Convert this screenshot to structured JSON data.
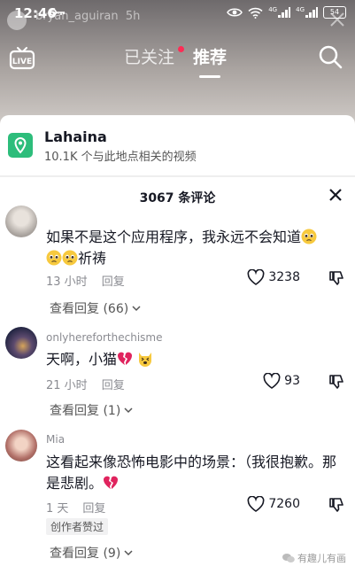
{
  "status_bar": {
    "time": "12:46",
    "signal_1": "4G",
    "signal_2": "4G",
    "battery": "54"
  },
  "underlay": {
    "username": "bryan_aguiran",
    "age": "5h"
  },
  "nav": {
    "live_label": "LIVE",
    "tab_following": "已关注",
    "tab_recommended": "推荐"
  },
  "location": {
    "name": "Lahaina",
    "subtitle": "10.1K 个与此地点相关的视频"
  },
  "comments_panel": {
    "title": "3067 条评论"
  },
  "comments": [
    {
      "username": "",
      "text_line1": "如果不是这个应用程序，我永远不会知道",
      "text_line2": "祈祷",
      "time": "13 小时",
      "reply_label": "回复",
      "likes": "3238",
      "view_replies": "查看回复 (66)"
    },
    {
      "username": "onlyhereforthechisme",
      "text": "天啊，小猫",
      "time": "21 小时",
      "reply_label": "回复",
      "likes": "93",
      "view_replies": "查看回复 (1)"
    },
    {
      "username": "Mia",
      "text": "这看起来像恐怖电影中的场景：（我很抱歉。那是悲剧。",
      "time": "1 天",
      "reply_label": "回复",
      "likes": "7260",
      "badge": "创作者赞过",
      "view_replies": "查看回复 (9)"
    }
  ],
  "watermark": {
    "text": "有趣儿有画"
  },
  "colors": {
    "accent_red": "#fe2c55",
    "location_green": "#2dbd7b",
    "broken_heart": "#e0245e"
  }
}
